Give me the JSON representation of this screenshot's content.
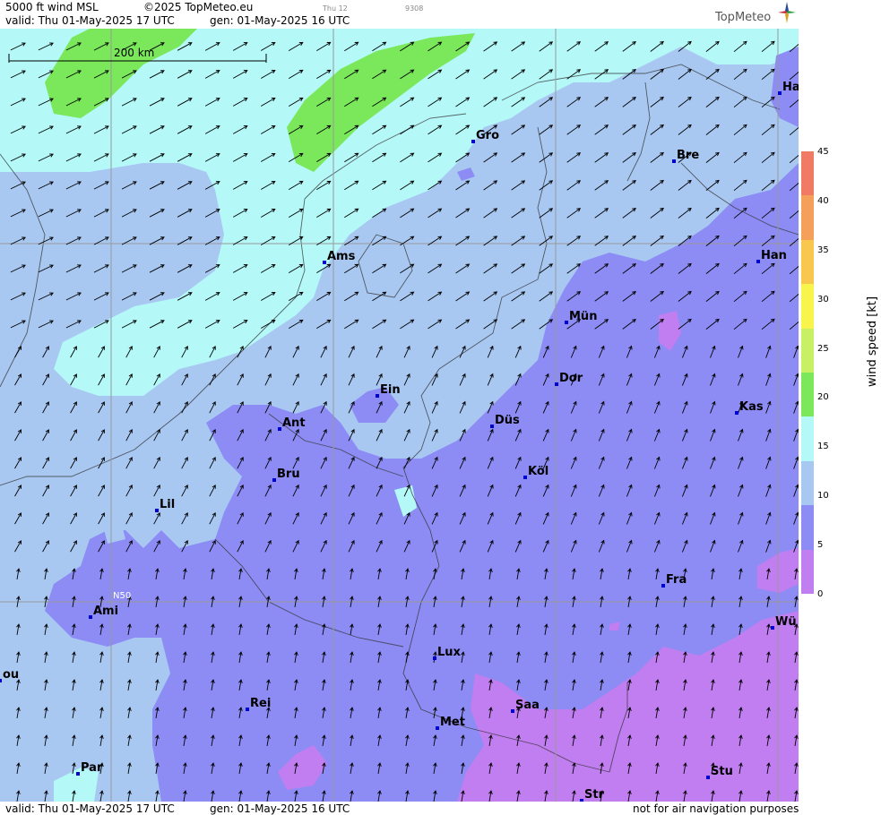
{
  "header": {
    "product": "5000 ft wind MSL",
    "copyright": "©2025 TopMeteo.eu",
    "valid": "valid:  Thu  01-May-2025  17 UTC",
    "gen": "gen: 01-May-2025 16 UTC",
    "small_tag1": "Thu 12",
    "small_tag2": "9308",
    "logo": "TopMeteo"
  },
  "map": {
    "scalebar": "200 km",
    "grid_label": "N50",
    "cities": [
      {
        "name": "Ha"
      },
      {
        "name": "Gro"
      },
      {
        "name": "Bre"
      },
      {
        "name": "Ams"
      },
      {
        "name": "Han"
      },
      {
        "name": "Mün"
      },
      {
        "name": "Ein"
      },
      {
        "name": "Dor"
      },
      {
        "name": "Kas"
      },
      {
        "name": "Ant"
      },
      {
        "name": "Düs"
      },
      {
        "name": "Bru"
      },
      {
        "name": "Köl"
      },
      {
        "name": "Lil"
      },
      {
        "name": "Fra"
      },
      {
        "name": "Ami"
      },
      {
        "name": "Wü"
      },
      {
        "name": "Lux"
      },
      {
        "name": "ou"
      },
      {
        "name": "Rei"
      },
      {
        "name": "Saa"
      },
      {
        "name": "Met"
      },
      {
        "name": "Par"
      },
      {
        "name": "Stu"
      },
      {
        "name": "Str"
      }
    ]
  },
  "colorbar": {
    "title": "wind  speed  [kt]",
    "labels": [
      "45",
      "40",
      "35",
      "30",
      "25",
      "20",
      "15",
      "10",
      "5",
      "0"
    ],
    "colors": [
      "#f07a64",
      "#f4a05a",
      "#f8c84e",
      "#f8f44c",
      "#c8f064",
      "#7ae85a",
      "#b4f8f8",
      "#a8c8f2",
      "#8c8cf4",
      "#c07ef0"
    ]
  },
  "footer": {
    "valid": "valid:  Thu  01-May-2025  17 UTC",
    "gen": "gen: 01-May-2025 16 UTC",
    "disclaimer": "not for air navigation purposes"
  },
  "colors": {
    "light_cyan": "#b4f8f8",
    "light_blue": "#a8c8f2",
    "blue_violet": "#8c8cf4",
    "violet": "#c07ef0",
    "green": "#7ae85a",
    "city_marker": "#0000cc"
  }
}
